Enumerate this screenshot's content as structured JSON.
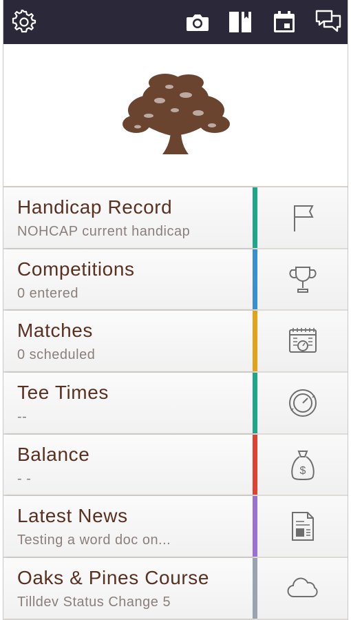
{
  "toolbar": {
    "icons": [
      "gear-icon",
      "camera-icon",
      "book-icon",
      "calendar-icon",
      "chat-icon"
    ]
  },
  "colors": {
    "topbar": "#2b2839",
    "tree": "#6b4430",
    "title_text": "#5a3020",
    "subtitle_text": "#8a7f7a",
    "icon_stroke": "#6e6e6e"
  },
  "menu": {
    "items": [
      {
        "title": "Handicap Record",
        "subtitle": "NOHCAP current handicap",
        "stripe_color": "#1fa68a",
        "icon": "flag-icon"
      },
      {
        "title": "Competitions",
        "subtitle": "0 entered",
        "stripe_color": "#3a8fd0",
        "icon": "trophy-icon"
      },
      {
        "title": "Matches",
        "subtitle": "0 scheduled",
        "stripe_color": "#e3a21a",
        "icon": "match-calendar-icon"
      },
      {
        "title": "Tee Times",
        "subtitle": "--",
        "stripe_color": "#1fa68a",
        "icon": "clock-icon"
      },
      {
        "title": "Balance",
        "subtitle": "- -",
        "stripe_color": "#e0402f",
        "icon": "money-bag-icon"
      },
      {
        "title": "Latest News",
        "subtitle": "Testing a word doc on...",
        "stripe_color": "#9a6fd6",
        "icon": "document-icon"
      },
      {
        "title": "Oaks & Pines Course",
        "subtitle": "Tilldev Status Change 5",
        "stripe_color": "#9aa3b0",
        "icon": "cloud-icon"
      }
    ]
  }
}
